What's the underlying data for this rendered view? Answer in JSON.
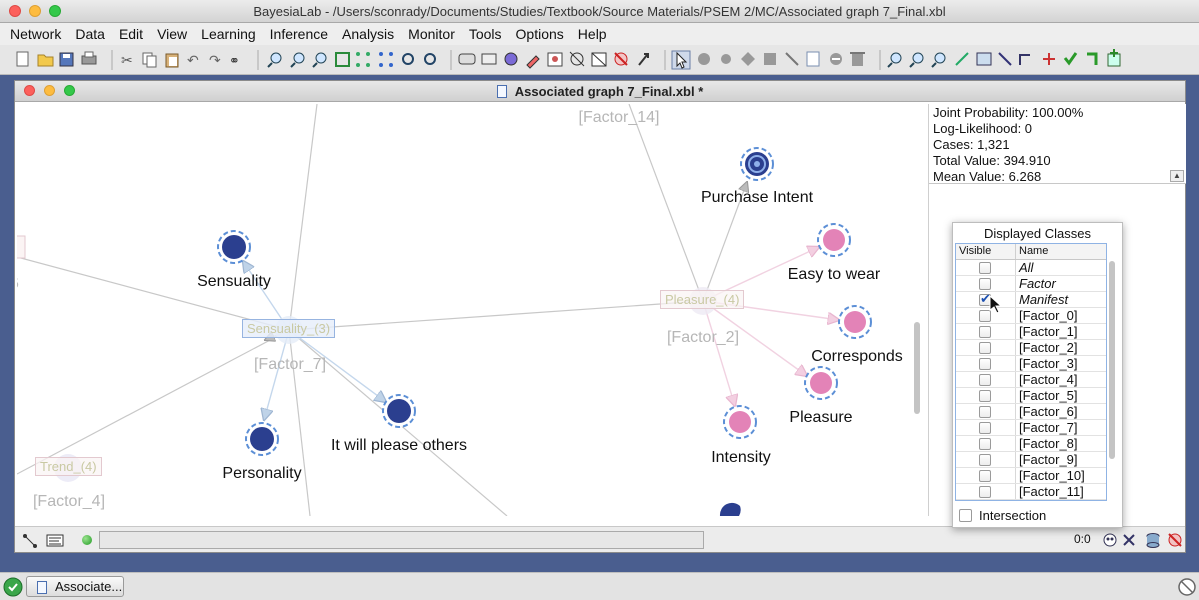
{
  "window": {
    "title": "BayesiaLab - /Users/sconrady/Documents/Studies/Textbook/Source Materials/PSEM 2/MC/Associated graph 7_Final.xbl"
  },
  "menu": [
    "Network",
    "Data",
    "Edit",
    "View",
    "Learning",
    "Inference",
    "Analysis",
    "Monitor",
    "Tools",
    "Options",
    "Help"
  ],
  "document": {
    "title": "Associated graph 7_Final.xbl *"
  },
  "graph": {
    "nodes": [
      {
        "label": "Purchase Intent",
        "kind": "target"
      },
      {
        "label": "Easy to wear",
        "kind": "pink"
      },
      {
        "label": "Corresponds",
        "kind": "pink"
      },
      {
        "label": "Pleasure",
        "kind": "pink"
      },
      {
        "label": "Intensity",
        "kind": "pink"
      },
      {
        "label": "Sensuality",
        "kind": "blue"
      },
      {
        "label": "Personality",
        "kind": "blue"
      },
      {
        "label": "It will please others",
        "kind": "blue"
      }
    ],
    "factor_labels": [
      "[Factor_14]",
      "[Factor_2]",
      "[Factor_7]",
      "[Factor_4]"
    ],
    "class_boxes": [
      "Pleasure_(4)",
      "Sensuality_(3)",
      "Trend_(4)"
    ]
  },
  "info": {
    "joint_probability": "Joint Probability: 100.00%",
    "log_likelihood": "Log-Likelihood: 0",
    "cases": "Cases: 1,321",
    "total_value": "Total Value: 394.910",
    "mean_value": "Mean Value: 6.268"
  },
  "classes_panel": {
    "title": "Displayed Classes",
    "col_visible": "Visible",
    "col_name": "Name",
    "rows": [
      {
        "name": "All",
        "checked": false,
        "italic": true
      },
      {
        "name": "Factor",
        "checked": false,
        "italic": true
      },
      {
        "name": "Manifest",
        "checked": true,
        "italic": true
      },
      {
        "name": "[Factor_0]",
        "checked": false,
        "italic": false
      },
      {
        "name": "[Factor_1]",
        "checked": false,
        "italic": false
      },
      {
        "name": "[Factor_2]",
        "checked": false,
        "italic": false
      },
      {
        "name": "[Factor_3]",
        "checked": false,
        "italic": false
      },
      {
        "name": "[Factor_4]",
        "checked": false,
        "italic": false
      },
      {
        "name": "[Factor_5]",
        "checked": false,
        "italic": false
      },
      {
        "name": "[Factor_6]",
        "checked": false,
        "italic": false
      },
      {
        "name": "[Factor_7]",
        "checked": false,
        "italic": false
      },
      {
        "name": "[Factor_8]",
        "checked": false,
        "italic": false
      },
      {
        "name": "[Factor_9]",
        "checked": false,
        "italic": false
      },
      {
        "name": "[Factor_10]",
        "checked": false,
        "italic": false
      },
      {
        "name": "[Factor_11]",
        "checked": false,
        "italic": false
      }
    ],
    "intersection_label": "Intersection"
  },
  "status": {
    "zoom": "0:0"
  },
  "taskbar": {
    "item": "Associate..."
  },
  "colors": {
    "node_blue": "#2b3f8f",
    "node_pink": "#e383b7",
    "node_ring": "#5c8fd6"
  }
}
